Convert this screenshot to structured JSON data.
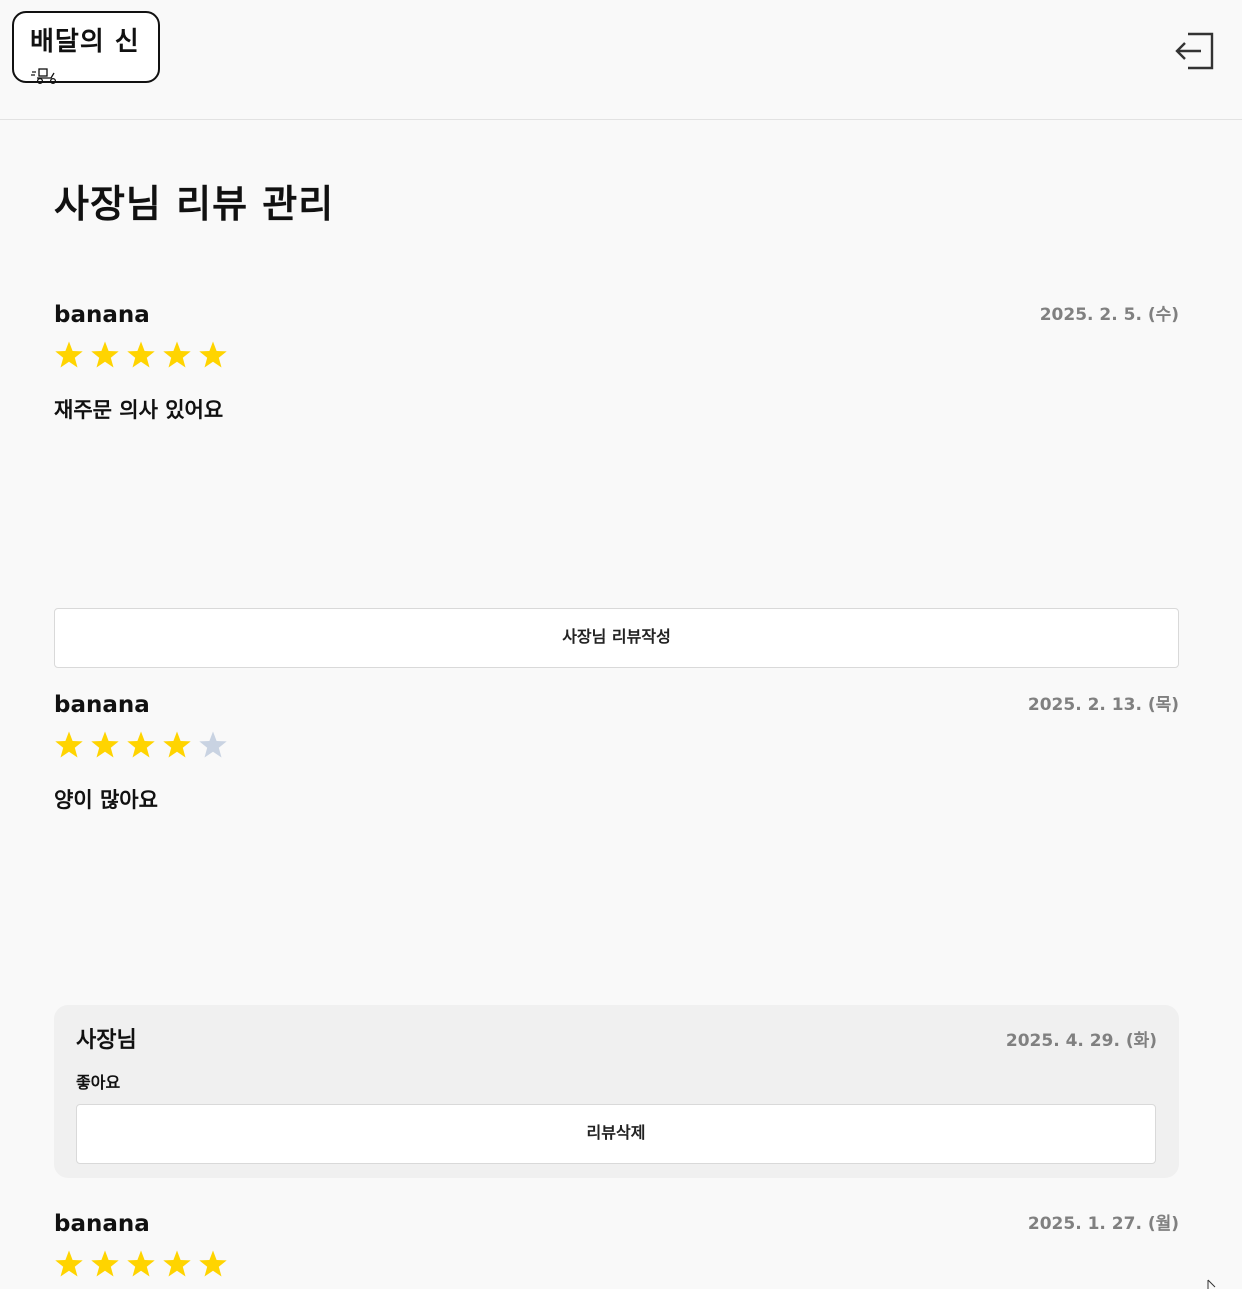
{
  "header": {
    "logo_text": "배달의 신",
    "logout_icon": "logout-icon"
  },
  "page": {
    "title": "사장님 리뷰 관리"
  },
  "colors": {
    "star_filled": "#FFD400",
    "star_empty": "#C9D3E2"
  },
  "reviews": [
    {
      "user": "banana",
      "date": "2025. 2. 5. (수)",
      "rating": 5,
      "content": "재주문 의사 있어요",
      "action_label": "사장님 리뷰작성"
    },
    {
      "user": "banana",
      "date": "2025. 2. 13. (목)",
      "rating": 4,
      "content": "양이 많아요",
      "reply": {
        "author": "사장님",
        "date": "2025. 4. 29. (화)",
        "content": "좋아요",
        "delete_label": "리뷰삭제"
      }
    },
    {
      "user": "banana",
      "date": "2025. 1. 27. (월)",
      "rating": 5
    }
  ]
}
